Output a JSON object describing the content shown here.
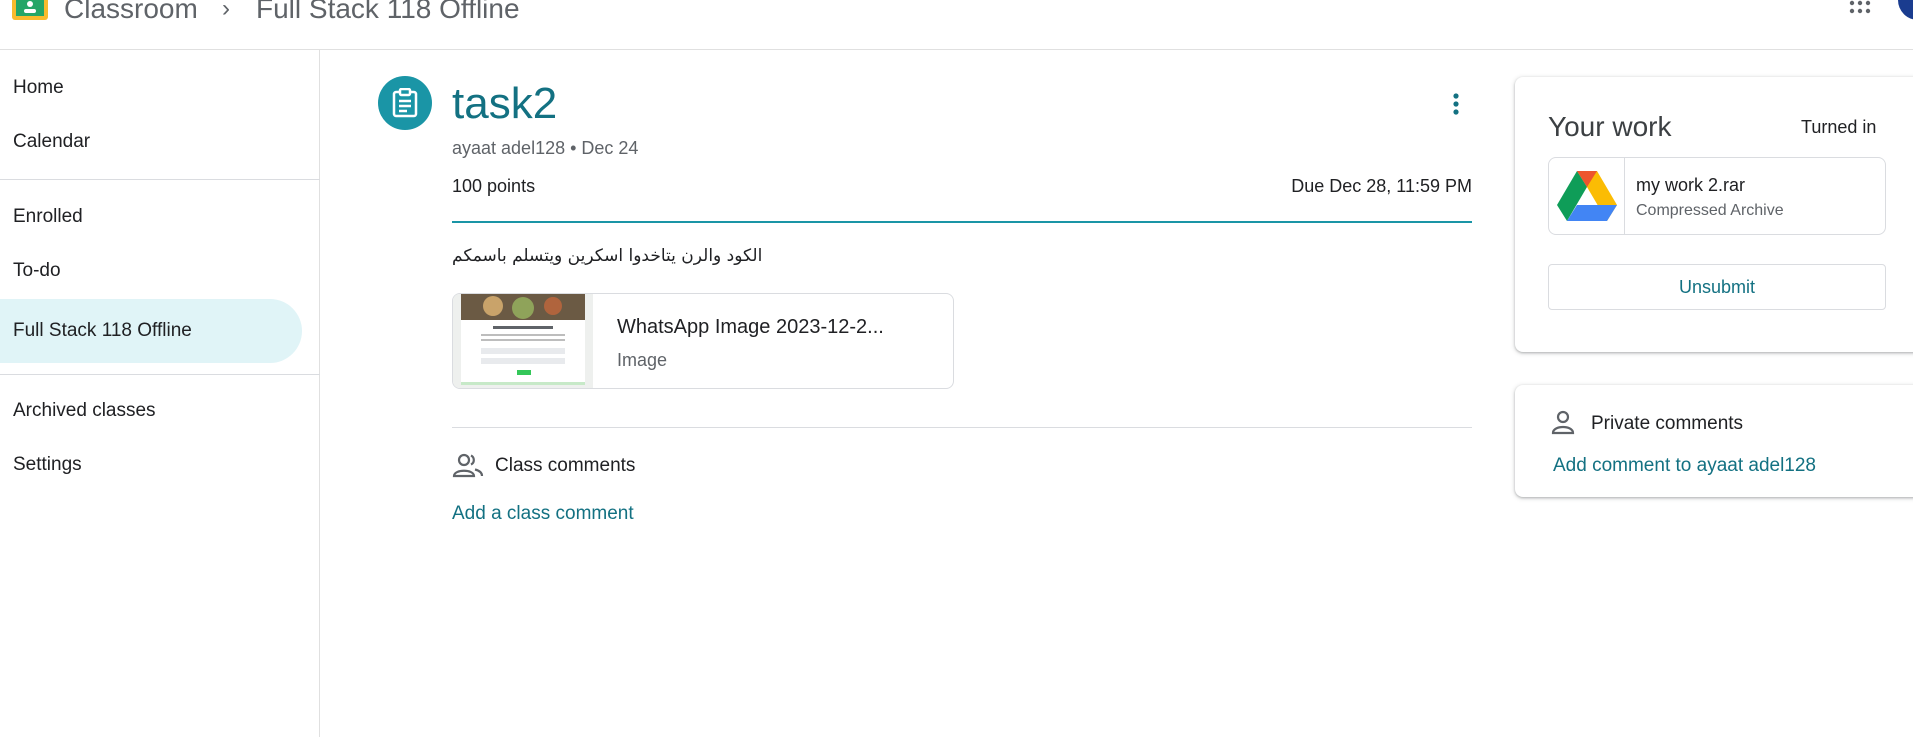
{
  "header": {
    "app_name": "Classroom",
    "separator": "›",
    "class_name": "Full Stack 118 Offline"
  },
  "sidebar": {
    "items": [
      {
        "label": "Home"
      },
      {
        "label": "Calendar"
      },
      {
        "label": "Enrolled"
      },
      {
        "label": "To-do"
      },
      {
        "label": "Full Stack 118 Offline",
        "active": true
      },
      {
        "label": "Archived classes"
      },
      {
        "label": "Settings"
      }
    ]
  },
  "assignment": {
    "title": "task2",
    "meta": "ayaat adel128 • Dec 24",
    "points": "100 points",
    "due": "Due Dec 28, 11:59 PM",
    "description": "الكود والرن يتاخدوا اسكرين ويتسلم باسمكم",
    "attachment": {
      "name": "WhatsApp Image 2023-12-2...",
      "type": "Image"
    }
  },
  "class_comments": {
    "label": "Class comments",
    "add_label": "Add a class comment"
  },
  "your_work": {
    "title": "Your work",
    "status": "Turned in",
    "file": {
      "name": "my work 2.rar",
      "type": "Compressed Archive"
    },
    "unsubmit_label": "Unsubmit"
  },
  "private_comments": {
    "label": "Private comments",
    "add_label": "Add comment to ayaat adel128"
  },
  "colors": {
    "accent": "#137182",
    "icon_bg": "#1a95a6",
    "active_nav_bg": "#e0f4f7"
  }
}
